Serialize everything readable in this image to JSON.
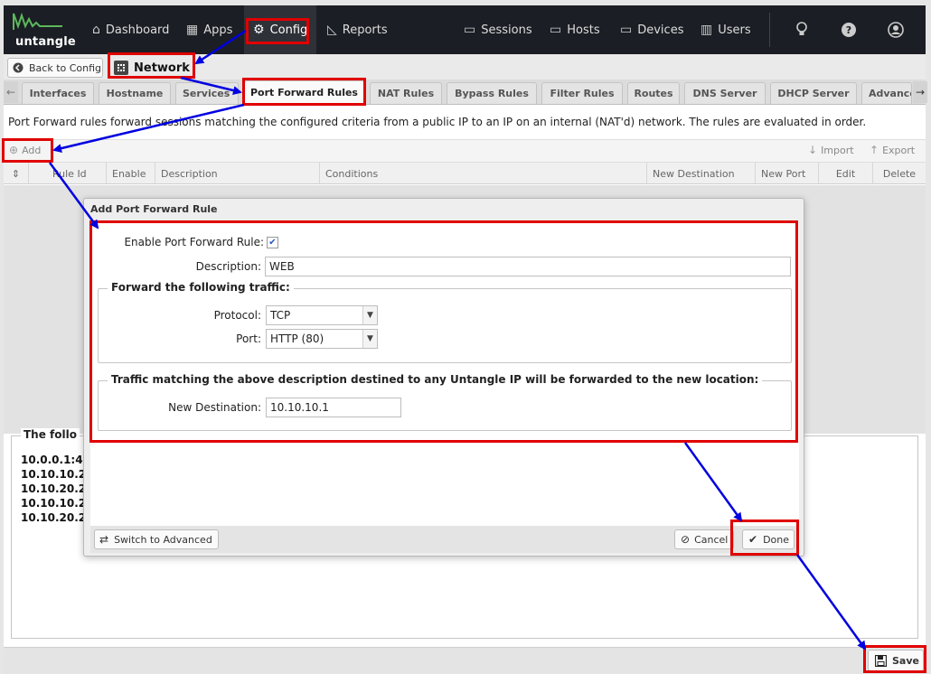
{
  "nav": {
    "logo_text": "untangle",
    "items": [
      {
        "label": "Dashboard",
        "icon": "home-icon"
      },
      {
        "label": "Apps",
        "icon": "grid-icon"
      },
      {
        "label": "Config",
        "icon": "gear-icon",
        "active": true
      },
      {
        "label": "Reports",
        "icon": "area-chart-icon"
      },
      {
        "label": "Sessions",
        "icon": "sessions-icon"
      },
      {
        "label": "Hosts",
        "icon": "monitor-icon"
      },
      {
        "label": "Devices",
        "icon": "devices-icon"
      },
      {
        "label": "Users",
        "icon": "users-icon"
      }
    ],
    "right_icons": [
      "lightbulb-icon",
      "help-icon",
      "account-icon"
    ]
  },
  "breadcrumb": {
    "back_label": "Back to Config",
    "title": "Network"
  },
  "tabs": [
    {
      "label": "Interfaces"
    },
    {
      "label": "Hostname"
    },
    {
      "label": "Services"
    },
    {
      "label": "Port Forward Rules",
      "active": true
    },
    {
      "label": "NAT Rules"
    },
    {
      "label": "Bypass Rules"
    },
    {
      "label": "Filter Rules"
    },
    {
      "label": "Routes"
    },
    {
      "label": "DNS Server"
    },
    {
      "label": "DHCP Server"
    },
    {
      "label": "Advanced"
    }
  ],
  "main": {
    "intro": "Port Forward rules forward sessions matching the configured criteria from a public IP to an IP on an internal (NAT'd) network. The rules are evaluated in order.",
    "toolbar": {
      "add": "Add",
      "import": "Import",
      "export": "Export"
    },
    "columns": [
      "Rule Id",
      "Enable",
      "Description",
      "Conditions",
      "New Destination",
      "New Port",
      "Edit",
      "Delete"
    ],
    "summary": {
      "legend": "The follo",
      "lines": [
        "10.0.0.1:4",
        "10.10.10.2",
        "10.10.20.2",
        "10.10.10.2",
        "10.10.20.2"
      ]
    },
    "save_label": "Save"
  },
  "dialog": {
    "title": "Add Port Forward Rule",
    "enable_label": "Enable Port Forward Rule:",
    "enable_checked": true,
    "description_label": "Description:",
    "description_value": "WEB",
    "fieldset1_legend": "Forward the following traffic:",
    "protocol_label": "Protocol:",
    "protocol_value": "TCP",
    "port_label": "Port:",
    "port_value": "HTTP (80)",
    "fieldset2_legend": "Traffic matching the above description destined to any Untangle IP will be forwarded to the new location:",
    "new_dest_label": "New Destination:",
    "new_dest_value": "10.10.10.1",
    "switch_label": "Switch to Advanced",
    "cancel_label": "Cancel",
    "done_label": "Done"
  },
  "colors": {
    "nav_bg": "#1b1e24",
    "logo_green": "#5cb85c",
    "highlight_red": "#e00000",
    "arrow_blue": "#0000e0"
  }
}
